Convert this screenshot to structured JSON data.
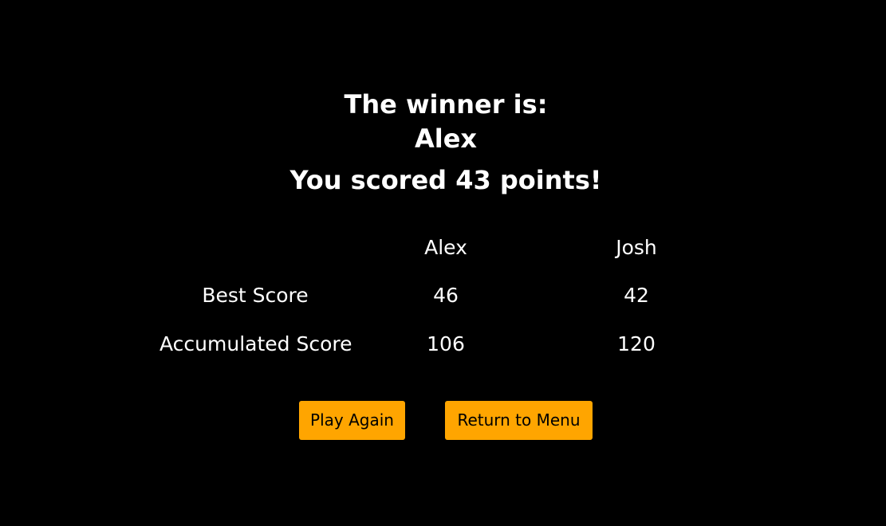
{
  "result": {
    "winner_label": "The winner is:",
    "winner_name": "Alex",
    "score_message": "You scored 43 points!"
  },
  "scoreboard": {
    "players": [
      "Alex",
      "Josh"
    ],
    "rows": [
      {
        "label": "Best Score",
        "values": [
          "46",
          "42"
        ]
      },
      {
        "label": "Accumulated Score",
        "values": [
          "106",
          "120"
        ]
      }
    ]
  },
  "actions": {
    "play_again_label": "Play Again",
    "return_menu_label": "Return to Menu"
  },
  "colors": {
    "background": "#000000",
    "text": "#ffffff",
    "button": "#ffa500",
    "button_text": "#000000"
  }
}
